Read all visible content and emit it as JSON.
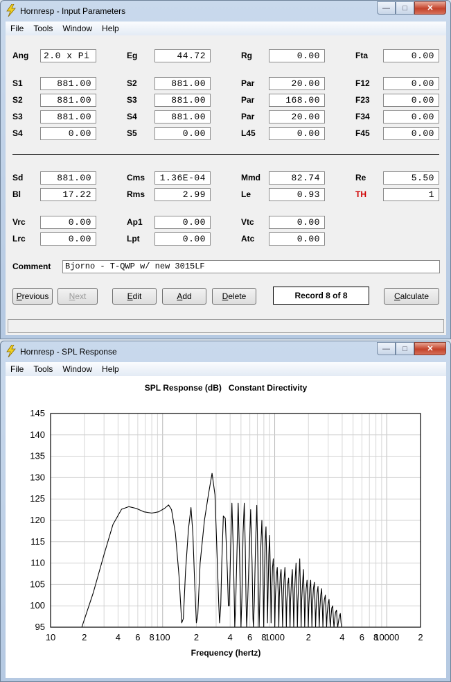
{
  "input_window": {
    "title": "Hornresp - Input Parameters",
    "menu": [
      "File",
      "Tools",
      "Window",
      "Help"
    ],
    "params": [
      {
        "label": "Ang",
        "value": "2.0 x Pi",
        "align": "left"
      },
      {
        "label": "Eg",
        "value": "44.72"
      },
      {
        "label": "Rg",
        "value": "0.00"
      },
      {
        "label": "Fta",
        "value": "0.00"
      },
      {
        "label": "S1",
        "value": "881.00"
      },
      {
        "label": "S2",
        "value": "881.00"
      },
      {
        "label": "Par",
        "value": "20.00"
      },
      {
        "label": "F12",
        "value": "0.00"
      },
      {
        "label": "S2",
        "value": "881.00"
      },
      {
        "label": "S3",
        "value": "881.00"
      },
      {
        "label": "Par",
        "value": "168.00"
      },
      {
        "label": "F23",
        "value": "0.00"
      },
      {
        "label": "S3",
        "value": "881.00"
      },
      {
        "label": "S4",
        "value": "881.00"
      },
      {
        "label": "Par",
        "value": "20.00"
      },
      {
        "label": "F34",
        "value": "0.00"
      },
      {
        "label": "S4",
        "value": "0.00"
      },
      {
        "label": "S5",
        "value": "0.00"
      },
      {
        "label": "L45",
        "value": "0.00"
      },
      {
        "label": "F45",
        "value": "0.00"
      },
      {
        "label": "Sd",
        "value": "881.00"
      },
      {
        "label": "Cms",
        "value": "1.36E-04"
      },
      {
        "label": "Mmd",
        "value": "82.74"
      },
      {
        "label": "Re",
        "value": "5.50"
      },
      {
        "label": "Bl",
        "value": "17.22"
      },
      {
        "label": "Rms",
        "value": "2.99"
      },
      {
        "label": "Le",
        "value": "0.93"
      },
      {
        "label": "TH",
        "value": "1",
        "color": "red"
      },
      {
        "label": "Vrc",
        "value": "0.00"
      },
      {
        "label": "Ap1",
        "value": "0.00"
      },
      {
        "label": "Vtc",
        "value": "0.00"
      },
      {
        "label": "Lrc",
        "value": "0.00"
      },
      {
        "label": "Lpt",
        "value": "0.00"
      },
      {
        "label": "Atc",
        "value": "0.00"
      }
    ],
    "comment_label": "Comment",
    "comment_value": "Bjorno - T-QWP w/ new 3015LF",
    "buttons": {
      "previous": {
        "u": "P",
        "rest": "revious"
      },
      "next": {
        "u": "N",
        "rest": "ext"
      },
      "edit": {
        "u": "E",
        "rest": "dit"
      },
      "add": {
        "u": "A",
        "rest": "dd"
      },
      "delete": {
        "u": "D",
        "rest": "elete"
      },
      "calculate": {
        "u": "C",
        "rest": "alculate"
      }
    },
    "record": "Record 8 of 8"
  },
  "spl_window": {
    "title": "Hornresp - SPL Response",
    "menu": [
      "File",
      "Tools",
      "Window",
      "Help"
    ]
  },
  "chart_data": {
    "type": "line",
    "title": "SPL Response (dB)   Constant Directivity",
    "xlabel": "Frequency (hertz)",
    "ylabel": "",
    "x_scale": "log",
    "xlim": [
      10,
      20000
    ],
    "ylim": [
      95,
      145
    ],
    "y_ticks": [
      95,
      100,
      105,
      110,
      115,
      120,
      125,
      130,
      135,
      140,
      145
    ],
    "x_ticks": [
      {
        "f": 10,
        "label": "10"
      },
      {
        "f": 20,
        "label": "2"
      },
      {
        "f": 40,
        "label": "4"
      },
      {
        "f": 60,
        "label": "6"
      },
      {
        "f": 80,
        "label": "8"
      },
      {
        "f": 100,
        "label": "100"
      },
      {
        "f": 200,
        "label": "2"
      },
      {
        "f": 400,
        "label": "4"
      },
      {
        "f": 600,
        "label": "6"
      },
      {
        "f": 800,
        "label": "8"
      },
      {
        "f": 1000,
        "label": "1000"
      },
      {
        "f": 2000,
        "label": "2"
      },
      {
        "f": 4000,
        "label": "4"
      },
      {
        "f": 6000,
        "label": "6"
      },
      {
        "f": 8000,
        "label": "8"
      },
      {
        "f": 10000,
        "label": "10000"
      },
      {
        "f": 20000,
        "label": "2"
      }
    ],
    "grid": true,
    "series": [
      {
        "name": "",
        "color": "#000000",
        "points": [
          [
            19,
            95
          ],
          [
            24,
            103
          ],
          [
            30,
            112
          ],
          [
            36,
            119
          ],
          [
            43,
            122.6
          ],
          [
            50,
            123.2
          ],
          [
            58,
            122.8
          ],
          [
            68,
            122
          ],
          [
            80,
            121.7
          ],
          [
            92,
            122
          ],
          [
            104,
            122.8
          ],
          [
            113,
            123.6
          ],
          [
            120,
            122.5
          ],
          [
            130,
            117
          ],
          [
            140,
            107
          ],
          [
            148,
            96
          ],
          [
            153,
            97
          ],
          [
            160,
            108
          ],
          [
            170,
            118
          ],
          [
            179,
            123
          ],
          [
            186,
            117
          ],
          [
            194,
            104
          ],
          [
            200,
            96
          ],
          [
            206,
            98
          ],
          [
            216,
            110
          ],
          [
            236,
            120
          ],
          [
            256,
            126
          ],
          [
            276,
            131
          ],
          [
            293,
            126
          ],
          [
            305,
            113
          ],
          [
            316,
            101
          ],
          [
            322,
            96
          ],
          [
            330,
            100
          ],
          [
            337,
            110
          ],
          [
            348,
            121
          ],
          [
            362,
            120.5
          ],
          [
            378,
            108
          ],
          [
            386,
            100
          ],
          [
            393,
            100
          ],
          [
            404,
            113
          ],
          [
            415,
            124
          ],
          [
            427,
            113
          ],
          [
            436,
            101
          ],
          [
            440,
            95
          ],
          [
            448,
            100
          ],
          [
            460,
            112
          ],
          [
            472,
            124
          ],
          [
            484,
            113
          ],
          [
            493,
            103
          ],
          [
            500,
            95
          ],
          [
            510,
            102
          ],
          [
            522,
            117
          ],
          [
            535,
            124
          ],
          [
            546,
            114
          ],
          [
            555,
            101
          ],
          [
            562,
            95
          ],
          [
            572,
            100
          ],
          [
            590,
            111
          ],
          [
            610,
            122.5
          ],
          [
            628,
            110
          ],
          [
            640,
            97
          ],
          [
            646,
            95
          ],
          [
            658,
            101
          ],
          [
            674,
            114
          ],
          [
            692,
            123.5
          ],
          [
            708,
            111
          ],
          [
            720,
            99
          ],
          [
            726,
            95
          ],
          [
            738,
            103
          ],
          [
            752,
            114
          ],
          [
            768,
            120
          ],
          [
            784,
            110
          ],
          [
            794,
            98
          ],
          [
            798,
            95
          ],
          [
            808,
            105
          ],
          [
            822,
            115
          ],
          [
            836,
            118.5
          ],
          [
            852,
            108
          ],
          [
            862,
            96
          ],
          [
            872,
            103
          ],
          [
            886,
            112
          ],
          [
            900,
            116.5
          ],
          [
            916,
            107
          ],
          [
            928,
            96
          ],
          [
            940,
            103
          ],
          [
            956,
            109
          ],
          [
            972,
            111
          ],
          [
            990,
            104
          ],
          [
            1002,
            95
          ],
          [
            1014,
            102
          ],
          [
            1034,
            107
          ],
          [
            1054,
            109
          ],
          [
            1074,
            103
          ],
          [
            1088,
            95
          ],
          [
            1100,
            102
          ],
          [
            1120,
            107
          ],
          [
            1140,
            108.5
          ],
          [
            1160,
            102
          ],
          [
            1176,
            95
          ],
          [
            1190,
            101
          ],
          [
            1210,
            106
          ],
          [
            1234,
            109
          ],
          [
            1254,
            103
          ],
          [
            1270,
            95
          ],
          [
            1284,
            101
          ],
          [
            1306,
            105
          ],
          [
            1330,
            106.5
          ],
          [
            1352,
            101
          ],
          [
            1370,
            95
          ],
          [
            1384,
            101
          ],
          [
            1410,
            105.5
          ],
          [
            1436,
            108.5
          ],
          [
            1460,
            102
          ],
          [
            1478,
            95
          ],
          [
            1494,
            101
          ],
          [
            1520,
            106
          ],
          [
            1550,
            110
          ],
          [
            1576,
            103
          ],
          [
            1594,
            95
          ],
          [
            1612,
            101
          ],
          [
            1640,
            106
          ],
          [
            1672,
            111
          ],
          [
            1700,
            103
          ],
          [
            1720,
            95
          ],
          [
            1738,
            101
          ],
          [
            1770,
            105
          ],
          [
            1804,
            108.5
          ],
          [
            1832,
            102
          ],
          [
            1852,
            95
          ],
          [
            1872,
            100
          ],
          [
            1908,
            104
          ],
          [
            1944,
            106
          ],
          [
            1974,
            101
          ],
          [
            1994,
            95
          ],
          [
            2016,
            100
          ],
          [
            2054,
            104
          ],
          [
            2094,
            106
          ],
          [
            2126,
            100
          ],
          [
            2148,
            95
          ],
          [
            2172,
            100
          ],
          [
            2214,
            104
          ],
          [
            2258,
            105.5
          ],
          [
            2292,
            100
          ],
          [
            2316,
            95
          ],
          [
            2342,
            99
          ],
          [
            2386,
            103
          ],
          [
            2434,
            104.5
          ],
          [
            2470,
            99
          ],
          [
            2496,
            95
          ],
          [
            2524,
            99
          ],
          [
            2574,
            102.5
          ],
          [
            2624,
            104
          ],
          [
            2664,
            99
          ],
          [
            2692,
            95
          ],
          [
            2722,
            99
          ],
          [
            2776,
            101.5
          ],
          [
            2830,
            102.5
          ],
          [
            2874,
            98
          ],
          [
            2904,
            95
          ],
          [
            2936,
            98
          ],
          [
            2994,
            100.5
          ],
          [
            3054,
            101.5
          ],
          [
            3100,
            97
          ],
          [
            3134,
            95
          ],
          [
            3168,
            97
          ],
          [
            3230,
            99.5
          ],
          [
            3294,
            100
          ],
          [
            3344,
            96.5
          ],
          [
            3380,
            95
          ],
          [
            3420,
            96.5
          ],
          [
            3490,
            98.5
          ],
          [
            3560,
            99
          ],
          [
            3612,
            96
          ],
          [
            3650,
            95
          ],
          [
            3694,
            96
          ],
          [
            3770,
            97.5
          ],
          [
            3850,
            98.2
          ],
          [
            3910,
            96
          ],
          [
            3960,
            95
          ]
        ]
      }
    ]
  }
}
